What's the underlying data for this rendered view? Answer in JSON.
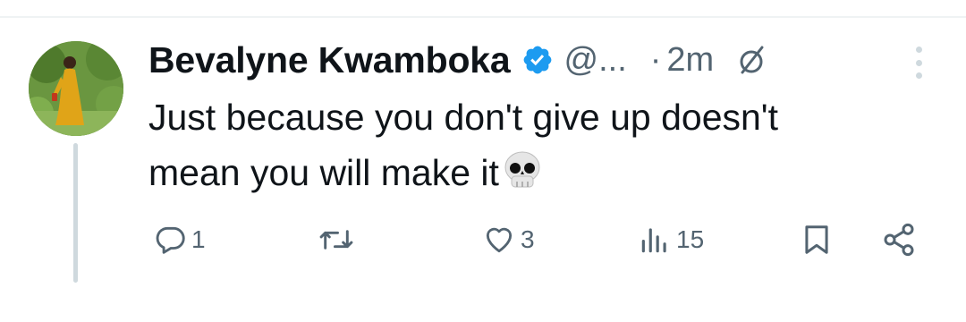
{
  "tweet": {
    "author_name": "Bevalyne Kwamboka",
    "handle": "@...",
    "separator": "·",
    "time": "2m",
    "text_line1": "Just because you don't give up doesn't",
    "text_line2": "mean you will make it",
    "emoji": "💀"
  },
  "actions": {
    "reply_count": "1",
    "retweet_count": "",
    "like_count": "3",
    "views_count": "15"
  },
  "colors": {
    "text": "#0f1419",
    "secondary": "#536471",
    "verified": "#1d9bf0",
    "divider": "#eff3f4",
    "thread_line": "#cfd9de"
  },
  "icons": [
    "verified-badge-icon",
    "edited-icon",
    "more-icon",
    "reply-icon",
    "retweet-icon",
    "like-icon",
    "views-icon",
    "bookmark-icon",
    "share-icon",
    "skull-emoji"
  ]
}
